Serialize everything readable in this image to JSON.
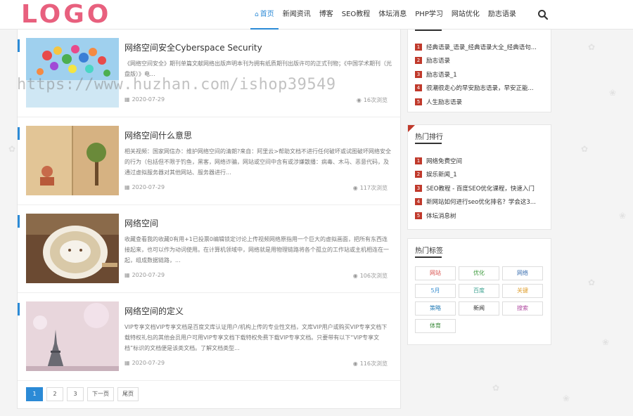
{
  "header": {
    "logo": "LOGO",
    "nav": [
      {
        "label": "首页",
        "active": true
      },
      {
        "label": "新闻资讯"
      },
      {
        "label": "博客"
      },
      {
        "label": "SEO教程"
      },
      {
        "label": "体坛消息"
      },
      {
        "label": "PHP学习"
      },
      {
        "label": "网站优化"
      },
      {
        "label": "励志语录"
      }
    ]
  },
  "articles": [
    {
      "title": "网络空间安全Cyberspace Security",
      "excerpt": "《网络空间安全》期刊单篇文献网络出版声明本刊为拥有纸质期刊出版许可的正式刊物；《中国学术期刊（光盘版）》电...",
      "date": "2020-07-29",
      "views": "16次浏览"
    },
    {
      "title": "网络空间什么意思",
      "excerpt": "相关视频：国家网信办：维护网络空间的清朗?来自：阿里云>帮助文档不进行任何破坏或试图破坏网络安全的行为（包括但不限于钓鱼，黑客，网络诈骗，网站或空间中含有或涉嫌散播：病毒、木马、恶意代码，及通过虚拟服务器对其他网站、服务器进行...",
      "date": "2020-07-29",
      "views": "117次浏览"
    },
    {
      "title": "网络空间",
      "excerpt": "收藏查看我的收藏0有用+1已投票0编辑锁定讨论上传视频网络原指用一个巨大的虚拟画面，把所有东西连接起来，也可以作为动词使用。在计算机领域中，网络就是用物理链路将各个孤立的工作站或主机相连在一起，组成数据链路，...",
      "date": "2020-07-29",
      "views": "106次浏览"
    },
    {
      "title": "网络空间的定义",
      "excerpt": "VIP专享文档VIP专享文档是百度文库认证用户/机构上传的专业性文档，文库VIP用户或购买VIP专享文档下载特权礼包的其他会员用户可用VIP专享文档下载特权免费下载VIP专享文档。只要带有以下“VIP专享文档”标识的文档便是该类文档。了解文档类型...",
      "date": "2020-07-29",
      "views": "116次浏览"
    }
  ],
  "pagination": [
    "1",
    "2",
    "3",
    "下一页",
    "尾页"
  ],
  "sidebar": {
    "latest": {
      "title": "",
      "items": [
        {
          "num": "1",
          "text": "经典语录_语录_经典语录大全_经典语句..."
        },
        {
          "num": "2",
          "text": "励志语录"
        },
        {
          "num": "3",
          "text": "励志语录_1"
        },
        {
          "num": "4",
          "text": "很潮很走心的早安励志语录，早安正能..."
        },
        {
          "num": "5",
          "text": "人生励志语录"
        }
      ]
    },
    "hot": {
      "title": "热门排行",
      "items": [
        {
          "num": "1",
          "text": "网络免费空间"
        },
        {
          "num": "2",
          "text": "娱乐新闻_1"
        },
        {
          "num": "3",
          "text": "SEO教程 - 百度SEO优化课程，快速入门"
        },
        {
          "num": "4",
          "text": "新网站如何进行seo优化排名？学会这3..."
        },
        {
          "num": "5",
          "text": "体坛消息树"
        }
      ]
    },
    "tags": {
      "title": "热门标签",
      "items": [
        {
          "label": "网站",
          "color": "#d9534f"
        },
        {
          "label": "优化",
          "color": "#3c9a3c"
        },
        {
          "label": "网络",
          "color": "#3a6fb0"
        },
        {
          "label": "5月",
          "color": "#3a8fd0"
        },
        {
          "label": "百度",
          "color": "#3aa08f"
        },
        {
          "label": "关键",
          "color": "#e0a030"
        },
        {
          "label": "策略",
          "color": "#2a7fb8"
        },
        {
          "label": "新闻",
          "color": "#333333"
        },
        {
          "label": "搜索",
          "color": "#b04aa0"
        },
        {
          "label": "体育",
          "color": "#3a8a3a"
        }
      ]
    }
  },
  "watermark": "https://www.huzhan.com/ishop39549",
  "colors": {
    "accent": "#2b8ad6",
    "rank": "#c0392b",
    "logo": "#e8607e"
  }
}
